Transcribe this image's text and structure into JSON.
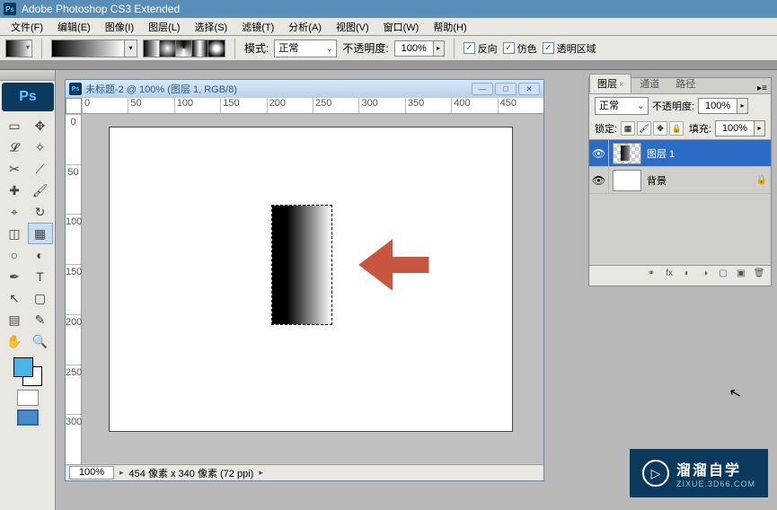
{
  "app": {
    "title": "Adobe Photoshop CS3 Extended"
  },
  "menu": {
    "file": "文件(F)",
    "edit": "编辑(E)",
    "image": "图像(I)",
    "layer": "图层(L)",
    "select": "选择(S)",
    "filter": "滤镜(T)",
    "analysis": "分析(A)",
    "view": "视图(V)",
    "window": "窗口(W)",
    "help": "帮助(H)"
  },
  "options": {
    "mode_label": "模式:",
    "mode_value": "正常",
    "opacity_label": "不透明度:",
    "opacity_value": "100%",
    "reverse": "反向",
    "dither": "仿色",
    "transparency": "透明区域"
  },
  "document": {
    "title": "未标题-2 @ 100% (图层 1, RGB/8)",
    "zoom": "100%",
    "status": "454 像素 x 340 像素 (72 ppi)",
    "ruler_h": [
      "0",
      "50",
      "100",
      "150",
      "200",
      "250",
      "300",
      "350",
      "400",
      "450"
    ],
    "ruler_v": [
      "0",
      "5",
      "0",
      "1",
      "0",
      "0",
      "1",
      "5",
      "0",
      "2",
      "0",
      "0",
      "2",
      "5",
      "0",
      "3",
      "0"
    ]
  },
  "panels": {
    "tabs": {
      "layers": "图层",
      "channels": "通道",
      "paths": "路径"
    },
    "blend_mode": "正常",
    "opacity_label": "不透明度:",
    "opacity_value": "100%",
    "lock_label": "锁定:",
    "fill_label": "填充:",
    "fill_value": "100%",
    "layers": [
      {
        "name": "图层 1",
        "locked": false
      },
      {
        "name": "背景",
        "locked": true
      }
    ]
  },
  "watermark": {
    "title": "溜溜自学",
    "url": "ZIXUE.3D66.COM"
  }
}
